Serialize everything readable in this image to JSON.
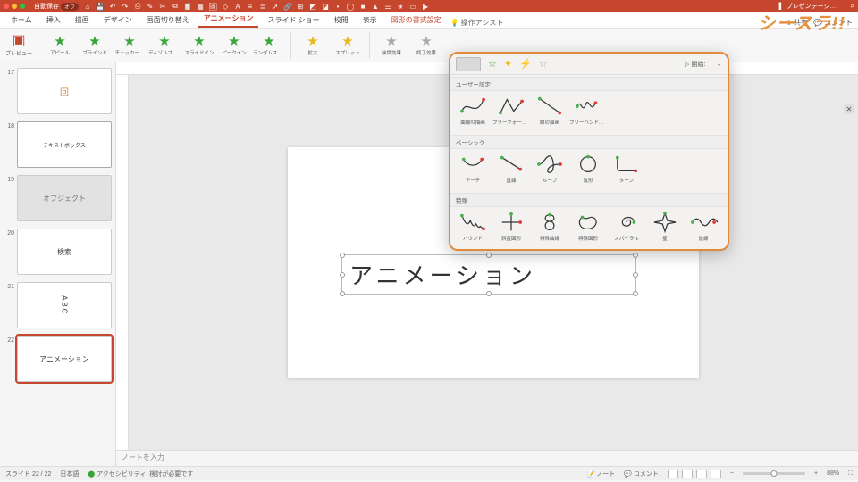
{
  "brand": "シースラ!!",
  "menubar": {
    "autosave_label": "自動保存",
    "autosave_state": "オフ",
    "doc_title": "プレゼンテーシ…"
  },
  "tabs": {
    "items": [
      "ホーム",
      "挿入",
      "描画",
      "デザイン",
      "画面切り替え",
      "アニメーション",
      "スライド ショー",
      "校閲",
      "表示"
    ],
    "active_index": 5,
    "format_tab": "図形の書式設定",
    "assist": "操作アシスト",
    "share": "共有",
    "comments": "コメント"
  },
  "ribbon": {
    "preview": "プレビュー",
    "effects_entrance": [
      {
        "label": "アピール",
        "color": "green"
      },
      {
        "label": "ブラインド",
        "color": "green"
      },
      {
        "label": "チェッカー…",
        "color": "green"
      },
      {
        "label": "ディゾルブイン",
        "color": "green"
      },
      {
        "label": "スライドイン",
        "color": "green"
      },
      {
        "label": "ピークイン",
        "color": "green"
      },
      {
        "label": "ランダムストラ…",
        "color": "green"
      }
    ],
    "effects_emphasis": [
      {
        "label": "拡大",
        "color": "yellow"
      },
      {
        "label": "スプリット",
        "color": "yellow"
      }
    ],
    "effects_exit": [
      {
        "label": "強調効果",
        "color": "outline"
      },
      {
        "label": "終了効果",
        "color": "outline"
      }
    ]
  },
  "gallery": {
    "start_label": "開始:",
    "sections": [
      {
        "title": "ユーザー設定",
        "items": [
          {
            "label": "曲線の描画",
            "shape": "curve"
          },
          {
            "label": "フリーフォームの描画",
            "shape": "freeform"
          },
          {
            "label": "線の描画",
            "shape": "line"
          },
          {
            "label": "フリーハンドの描画",
            "shape": "scribble"
          }
        ]
      },
      {
        "title": "ベーシック",
        "items": [
          {
            "label": "アーチ",
            "shape": "arc"
          },
          {
            "label": "直線",
            "shape": "segment"
          },
          {
            "label": "ループ",
            "shape": "loop"
          },
          {
            "label": "波形",
            "shape": "circle"
          },
          {
            "label": "ターン",
            "shape": "turn"
          }
        ]
      },
      {
        "title": "特殊",
        "items": [
          {
            "label": "バウンド",
            "shape": "bounce"
          },
          {
            "label": "斜置図形",
            "shape": "cross"
          },
          {
            "label": "特殊曲線",
            "shape": "figure8"
          },
          {
            "label": "特殊図形",
            "shape": "bean"
          },
          {
            "label": "スパイラル",
            "shape": "spiral"
          },
          {
            "label": "星",
            "shape": "star4"
          },
          {
            "label": "波線",
            "shape": "wave"
          }
        ]
      }
    ]
  },
  "thumbs": [
    {
      "num": "17",
      "text": "回",
      "style": "frame-orange"
    },
    {
      "num": "18",
      "text": "テキストボックス",
      "style": "small-text"
    },
    {
      "num": "19",
      "text": "オブジェクト",
      "style": "shaded"
    },
    {
      "num": "20",
      "text": "検索",
      "style": ""
    },
    {
      "num": "21",
      "text": "ABC",
      "style": "vert"
    },
    {
      "num": "22",
      "text": "アニメーション",
      "style": ""
    }
  ],
  "selected_thumb": 5,
  "canvas": {
    "textbox_text": "アニメーション"
  },
  "notes_placeholder": "ノートを入力",
  "status": {
    "slide_counter": "スライド 22 / 22",
    "language": "日本語",
    "accessibility": "アクセシビリティ: 検討が必要です",
    "notes_btn": "ノート",
    "comments_btn": "コメント",
    "zoom": "88%"
  }
}
